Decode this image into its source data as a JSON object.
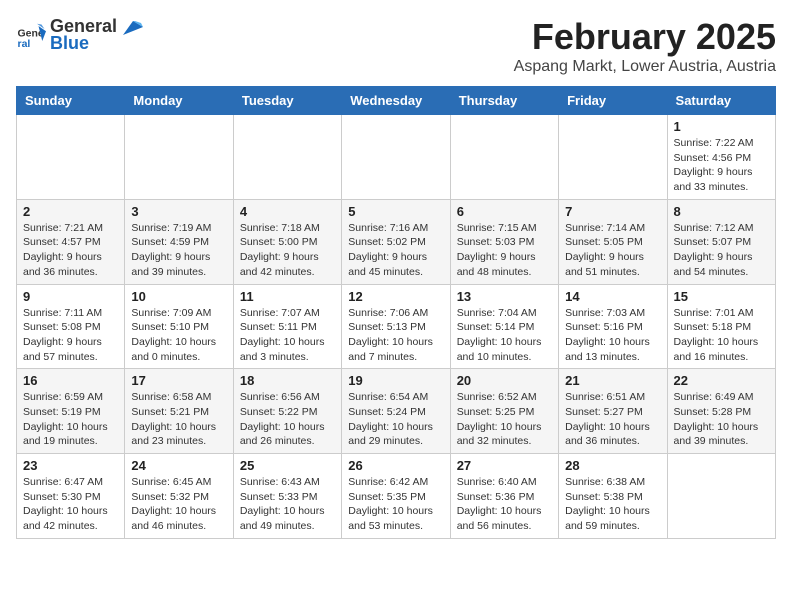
{
  "header": {
    "logo_general": "General",
    "logo_blue": "Blue",
    "month": "February 2025",
    "location": "Aspang Markt, Lower Austria, Austria"
  },
  "weekdays": [
    "Sunday",
    "Monday",
    "Tuesday",
    "Wednesday",
    "Thursday",
    "Friday",
    "Saturday"
  ],
  "weeks": [
    [
      {
        "day": "",
        "info": ""
      },
      {
        "day": "",
        "info": ""
      },
      {
        "day": "",
        "info": ""
      },
      {
        "day": "",
        "info": ""
      },
      {
        "day": "",
        "info": ""
      },
      {
        "day": "",
        "info": ""
      },
      {
        "day": "1",
        "info": "Sunrise: 7:22 AM\nSunset: 4:56 PM\nDaylight: 9 hours and 33 minutes."
      }
    ],
    [
      {
        "day": "2",
        "info": "Sunrise: 7:21 AM\nSunset: 4:57 PM\nDaylight: 9 hours and 36 minutes."
      },
      {
        "day": "3",
        "info": "Sunrise: 7:19 AM\nSunset: 4:59 PM\nDaylight: 9 hours and 39 minutes."
      },
      {
        "day": "4",
        "info": "Sunrise: 7:18 AM\nSunset: 5:00 PM\nDaylight: 9 hours and 42 minutes."
      },
      {
        "day": "5",
        "info": "Sunrise: 7:16 AM\nSunset: 5:02 PM\nDaylight: 9 hours and 45 minutes."
      },
      {
        "day": "6",
        "info": "Sunrise: 7:15 AM\nSunset: 5:03 PM\nDaylight: 9 hours and 48 minutes."
      },
      {
        "day": "7",
        "info": "Sunrise: 7:14 AM\nSunset: 5:05 PM\nDaylight: 9 hours and 51 minutes."
      },
      {
        "day": "8",
        "info": "Sunrise: 7:12 AM\nSunset: 5:07 PM\nDaylight: 9 hours and 54 minutes."
      }
    ],
    [
      {
        "day": "9",
        "info": "Sunrise: 7:11 AM\nSunset: 5:08 PM\nDaylight: 9 hours and 57 minutes."
      },
      {
        "day": "10",
        "info": "Sunrise: 7:09 AM\nSunset: 5:10 PM\nDaylight: 10 hours and 0 minutes."
      },
      {
        "day": "11",
        "info": "Sunrise: 7:07 AM\nSunset: 5:11 PM\nDaylight: 10 hours and 3 minutes."
      },
      {
        "day": "12",
        "info": "Sunrise: 7:06 AM\nSunset: 5:13 PM\nDaylight: 10 hours and 7 minutes."
      },
      {
        "day": "13",
        "info": "Sunrise: 7:04 AM\nSunset: 5:14 PM\nDaylight: 10 hours and 10 minutes."
      },
      {
        "day": "14",
        "info": "Sunrise: 7:03 AM\nSunset: 5:16 PM\nDaylight: 10 hours and 13 minutes."
      },
      {
        "day": "15",
        "info": "Sunrise: 7:01 AM\nSunset: 5:18 PM\nDaylight: 10 hours and 16 minutes."
      }
    ],
    [
      {
        "day": "16",
        "info": "Sunrise: 6:59 AM\nSunset: 5:19 PM\nDaylight: 10 hours and 19 minutes."
      },
      {
        "day": "17",
        "info": "Sunrise: 6:58 AM\nSunset: 5:21 PM\nDaylight: 10 hours and 23 minutes."
      },
      {
        "day": "18",
        "info": "Sunrise: 6:56 AM\nSunset: 5:22 PM\nDaylight: 10 hours and 26 minutes."
      },
      {
        "day": "19",
        "info": "Sunrise: 6:54 AM\nSunset: 5:24 PM\nDaylight: 10 hours and 29 minutes."
      },
      {
        "day": "20",
        "info": "Sunrise: 6:52 AM\nSunset: 5:25 PM\nDaylight: 10 hours and 32 minutes."
      },
      {
        "day": "21",
        "info": "Sunrise: 6:51 AM\nSunset: 5:27 PM\nDaylight: 10 hours and 36 minutes."
      },
      {
        "day": "22",
        "info": "Sunrise: 6:49 AM\nSunset: 5:28 PM\nDaylight: 10 hours and 39 minutes."
      }
    ],
    [
      {
        "day": "23",
        "info": "Sunrise: 6:47 AM\nSunset: 5:30 PM\nDaylight: 10 hours and 42 minutes."
      },
      {
        "day": "24",
        "info": "Sunrise: 6:45 AM\nSunset: 5:32 PM\nDaylight: 10 hours and 46 minutes."
      },
      {
        "day": "25",
        "info": "Sunrise: 6:43 AM\nSunset: 5:33 PM\nDaylight: 10 hours and 49 minutes."
      },
      {
        "day": "26",
        "info": "Sunrise: 6:42 AM\nSunset: 5:35 PM\nDaylight: 10 hours and 53 minutes."
      },
      {
        "day": "27",
        "info": "Sunrise: 6:40 AM\nSunset: 5:36 PM\nDaylight: 10 hours and 56 minutes."
      },
      {
        "day": "28",
        "info": "Sunrise: 6:38 AM\nSunset: 5:38 PM\nDaylight: 10 hours and 59 minutes."
      },
      {
        "day": "",
        "info": ""
      }
    ]
  ]
}
